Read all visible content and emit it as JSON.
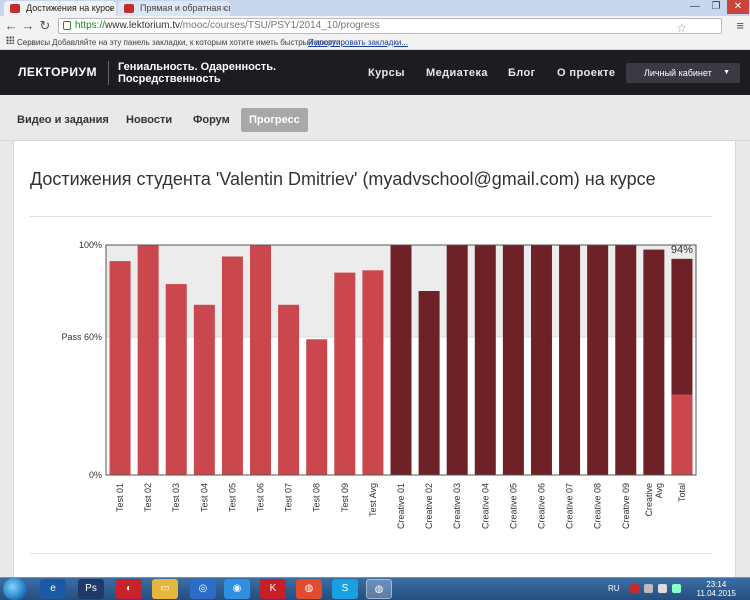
{
  "browser": {
    "tabs": [
      {
        "title": "Достижения на курсе PS",
        "close": "×"
      },
      {
        "title": "Прямая и обратная связ",
        "close": "×"
      }
    ],
    "window_controls": {
      "minimize": "—",
      "restore": "❐",
      "close": "✕"
    },
    "url_scheme": "https://",
    "url_host": "www.lektorium.tv",
    "url_path": "/mooc/courses/TSU/PSY1/2014_10/progress",
    "bookmarks": {
      "apps_label": "Сервисы",
      "hint": "Добавляйте на эту панель закладки, к которым хотите иметь быстрый доступ.",
      "import_link": "Импортировать закладки..."
    }
  },
  "site": {
    "logo": "ЛЕКТОРИУМ",
    "slogan": "Гениальность. Одаренность. Посредственность",
    "nav": [
      "Курсы",
      "Медиатека",
      "Блог",
      "О проекте"
    ],
    "cabinet": "Личный кабинет"
  },
  "course_tabs": [
    {
      "label": "Видео и задания",
      "active": false
    },
    {
      "label": "Новости",
      "active": false
    },
    {
      "label": "Форум",
      "active": false
    },
    {
      "label": "Прогресс",
      "active": true
    }
  ],
  "page": {
    "heading": "Достижения студента 'Valentin Dmitriev' (myadvschool@gmail.com) на курсе"
  },
  "chart_data": {
    "type": "bar",
    "title": "",
    "xlabel": "",
    "ylabel": "",
    "ylim": [
      0,
      100
    ],
    "y_ticks": [
      {
        "value": 0,
        "label": "0%"
      },
      {
        "value": 60,
        "label": "Pass 60%"
      },
      {
        "value": 100,
        "label": "100%"
      }
    ],
    "categories": [
      "Test 01",
      "Test 02",
      "Test 03",
      "Test 04",
      "Test 05",
      "Test 06",
      "Test 07",
      "Test 08",
      "Test 09",
      "Test Avg",
      "Creative 01",
      "Creative 02",
      "Creative 03",
      "Creative 04",
      "Creative 05",
      "Creative 06",
      "Creative 07",
      "Creative 08",
      "Creative 09",
      "Creative Avg",
      "Total"
    ],
    "values": [
      93,
      100,
      83,
      74,
      95,
      100,
      74,
      59,
      88,
      89,
      100,
      80,
      100,
      100,
      100,
      100,
      100,
      100,
      100,
      98,
      94
    ],
    "groups": [
      "test",
      "test",
      "test",
      "test",
      "test",
      "test",
      "test",
      "test",
      "test",
      "test-avg",
      "creative",
      "creative",
      "creative",
      "creative",
      "creative",
      "creative",
      "creative",
      "creative",
      "creative",
      "creative-avg",
      "total"
    ],
    "total_split": {
      "test_part": 35,
      "creative_part": 59
    },
    "total_label": "94%",
    "colors": {
      "test": "#c9474d",
      "creative": "#6e2126",
      "pass_band": "#ececec",
      "border": "#555555"
    },
    "grid": false,
    "legend": "none"
  },
  "taskbar": {
    "lang": "RU",
    "time": "23:14",
    "date": "11.04.2015"
  }
}
